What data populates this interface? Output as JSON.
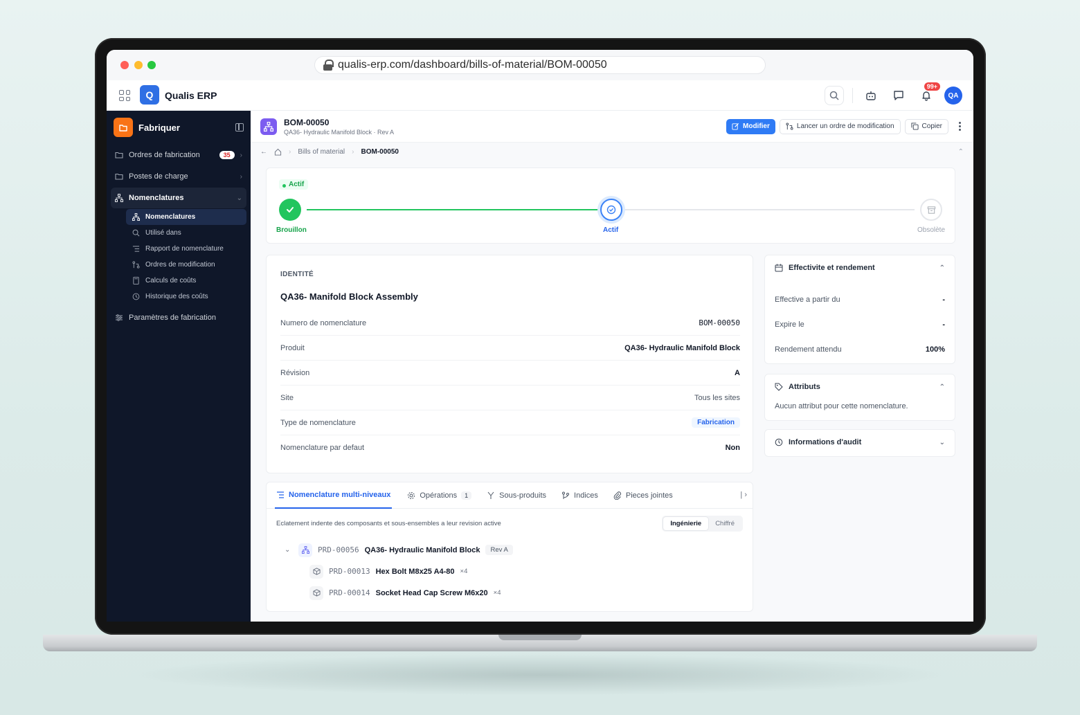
{
  "browser": {
    "url": "qualis-erp.com/dashboard/bills-of-material/BOM-00050"
  },
  "appbar": {
    "logo_letter": "Q",
    "app_name": "Qualis ERP",
    "notifications_badge": "99+",
    "avatar_initials": "QA"
  },
  "sidebar": {
    "title": "Fabriquer",
    "items": [
      {
        "label": "Ordres de fabrication",
        "count": "35"
      },
      {
        "label": "Postes de charge"
      },
      {
        "label": "Nomenclatures"
      },
      {
        "label": "Paramètres de fabrication"
      }
    ],
    "subitems": [
      {
        "label": "Nomenclatures"
      },
      {
        "label": "Utilisé dans"
      },
      {
        "label": "Rapport de nomenclature"
      },
      {
        "label": "Ordres de modification"
      },
      {
        "label": "Calculs de coûts"
      },
      {
        "label": "Historique des coûts"
      }
    ]
  },
  "header": {
    "title": "BOM-00050",
    "subtitle": "QA36- Hydraulic Manifold Block · Rev A",
    "modify_label": "Modifier",
    "launch_change_label": "Lancer un ordre de modification",
    "copy_label": "Copier"
  },
  "breadcrumb": {
    "parent": "Bills of material",
    "current": "BOM-00050"
  },
  "status": {
    "current_pill": "Actif",
    "steps": [
      {
        "label": "Brouillon"
      },
      {
        "label": "Actif"
      },
      {
        "label": "Obsolète"
      }
    ]
  },
  "identity": {
    "section_label": "IDENTITÉ",
    "title": "QA36- Manifold Block Assembly",
    "rows": [
      {
        "key": "Numero de nomenclature",
        "value": "BOM-00050"
      },
      {
        "key": "Produit",
        "value": "QA36- Hydraulic Manifold Block"
      },
      {
        "key": "Révision",
        "value": "A"
      },
      {
        "key": "Site",
        "value": "Tous les sites"
      },
      {
        "key": "Type de nomenclature",
        "value": "Fabrication"
      },
      {
        "key": "Nomenclature par defaut",
        "value": "Non"
      }
    ]
  },
  "effectivity": {
    "title": "Effectivite et rendement",
    "rows": [
      {
        "key": "Effective a partir du",
        "value": "-"
      },
      {
        "key": "Expire le",
        "value": "-"
      },
      {
        "key": "Rendement attendu",
        "value": "100%"
      }
    ]
  },
  "attributes": {
    "title": "Attributs",
    "empty_text": "Aucun attribut pour cette nomenclature."
  },
  "audit": {
    "title": "Informations d'audit"
  },
  "tabs": {
    "items": [
      {
        "label": "Nomenclature multi-niveaux"
      },
      {
        "label": "Opérations",
        "count": "1"
      },
      {
        "label": "Sous-produits"
      },
      {
        "label": "Indices"
      },
      {
        "label": "Pieces jointes"
      }
    ],
    "description": "Eclatement indente des composants et sous-ensembles a leur revision active",
    "view_options": [
      "Ingénierie",
      "Chiffré"
    ]
  },
  "tree": {
    "parent": {
      "code": "PRD-00056",
      "name": "QA36- Hydraulic Manifold Block",
      "rev": "Rev A"
    },
    "children": [
      {
        "code": "PRD-00013",
        "name": "Hex Bolt M8x25 A4-80",
        "qty": "×4"
      },
      {
        "code": "PRD-00014",
        "name": "Socket Head Cap Screw M6x20",
        "qty": "×4"
      }
    ]
  }
}
